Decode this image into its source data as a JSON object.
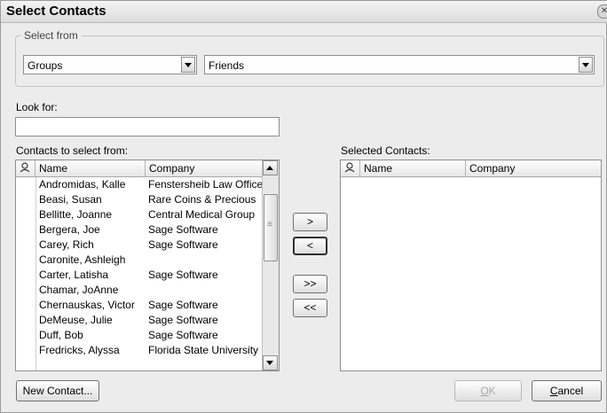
{
  "dialog": {
    "title": "Select Contacts",
    "close_glyph": "✕"
  },
  "select_from": {
    "legend": "Select from",
    "type_value": "Groups",
    "group_value": "Friends"
  },
  "look_for": {
    "label": "Look for:",
    "value": ""
  },
  "contacts": {
    "label": "Contacts to select from:",
    "columns": [
      "Name",
      "Company"
    ],
    "rows": [
      {
        "name": "Andromidas, Kalle",
        "company": "Fenstersheib Law Office"
      },
      {
        "name": "Beasi, Susan",
        "company": "Rare Coins & Precious"
      },
      {
        "name": "Bellitte, Joanne",
        "company": "Central Medical Group"
      },
      {
        "name": "Bergera, Joe",
        "company": "Sage Software"
      },
      {
        "name": "Carey, Rich",
        "company": "Sage Software"
      },
      {
        "name": "Caronite, Ashleigh",
        "company": ""
      },
      {
        "name": "Carter, Latisha",
        "company": "Sage Software"
      },
      {
        "name": "Chamar, JoAnne",
        "company": ""
      },
      {
        "name": "Chernauskas, Victor",
        "company": "Sage Software"
      },
      {
        "name": "DeMeuse, Julie",
        "company": "Sage Software"
      },
      {
        "name": "Duff, Bob",
        "company": "Sage Software"
      },
      {
        "name": "Fredricks, Alyssa",
        "company": "Florida State University"
      }
    ]
  },
  "selected": {
    "label": "Selected Contacts:",
    "columns": [
      "Name",
      "Company"
    ]
  },
  "transfer": {
    "add_one": ">",
    "remove_one": "<",
    "add_all": ">>",
    "remove_all": "<<"
  },
  "footer": {
    "new_contact": "New Contact...",
    "ok_mnemonic": "O",
    "ok_rest": "K",
    "cancel_mnemonic": "C",
    "cancel_rest": "ancel"
  }
}
